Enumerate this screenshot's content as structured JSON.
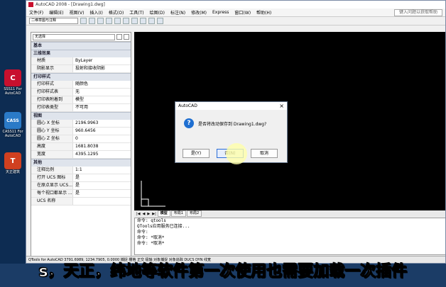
{
  "desktop": {
    "icons": [
      {
        "label": "SSS11 For AutoCAD",
        "glyph": "C",
        "color": "#c8102e"
      },
      {
        "label": "CASS11 For AutoCAD",
        "glyph": "CASS",
        "color": "#2a7ac7"
      },
      {
        "label": "天正建筑",
        "glyph": "T",
        "color": "#d04020"
      }
    ]
  },
  "window": {
    "title": "AutoCAD 2008 - [Drawing1.dwg]"
  },
  "menu": {
    "items": [
      "文件(F)",
      "编辑(E)",
      "视图(V)",
      "插入(I)",
      "格式(O)",
      "工具(T)",
      "绘图(D)",
      "标注(N)",
      "修改(M)",
      "Express",
      "窗口(W)",
      "帮助(H)"
    ],
    "help_placeholder": "键入问题以获取帮助"
  },
  "toolbar": {
    "workspace": "二维草图与注释"
  },
  "properties": {
    "selection": "无选择",
    "sections": [
      {
        "title": "基本",
        "rows": []
      },
      {
        "title": "三维效果",
        "rows": [
          {
            "k": "材质",
            "v": "ByLayer"
          },
          {
            "k": "阴影显示",
            "v": "投射和接收阴影"
          }
        ]
      },
      {
        "title": "打印样式",
        "rows": [
          {
            "k": "打印样式",
            "v": "随颜色"
          },
          {
            "k": "打印样式表",
            "v": "无"
          },
          {
            "k": "打印表附着到",
            "v": "模型"
          },
          {
            "k": "打印表类型",
            "v": "不可用"
          }
        ]
      },
      {
        "title": "视图",
        "rows": [
          {
            "k": "圆心 X 坐标",
            "v": "2196.9963"
          },
          {
            "k": "圆心 Y 坐标",
            "v": "960.6456"
          },
          {
            "k": "圆心 Z 坐标",
            "v": "0"
          },
          {
            "k": "高度",
            "v": "1681.8038"
          },
          {
            "k": "宽度",
            "v": "4395.1295"
          }
        ]
      },
      {
        "title": "其他",
        "rows": [
          {
            "k": "注释比例",
            "v": "1:1"
          },
          {
            "k": "打开 UCS 图标",
            "v": "是"
          },
          {
            "k": "在原点显示 UCS...",
            "v": "是"
          },
          {
            "k": "每个视口都显示 ...",
            "v": "是"
          },
          {
            "k": "UCS 名称",
            "v": ""
          }
        ]
      }
    ]
  },
  "tabs": [
    "模型",
    "布局1",
    "布局2"
  ],
  "command_lines": [
    "命令: qtools",
    "QTools应用服务已连接...",
    "命令:",
    "命令: *取消*",
    "命令: *取消*"
  ],
  "status_bar": "QTools for AutoCAD   3791.6989, 1234.7905, 0.0000   捕捉  栅格  正交  极轴  对象捕捉  对象追踪  DUCS  DYN  线宽",
  "dialog": {
    "title": "AutoCAD",
    "close": "×",
    "message": "是否将改动保存到 Drawing1.dwg?",
    "icon": "?",
    "buttons": [
      {
        "label": "是(Y)",
        "focused": false
      },
      {
        "label": "否(N)",
        "focused": true
      },
      {
        "label": "取消",
        "focused": false
      }
    ]
  },
  "subtitle": "s，天正，纬地等软件第一次使用也需要加载一次插件"
}
